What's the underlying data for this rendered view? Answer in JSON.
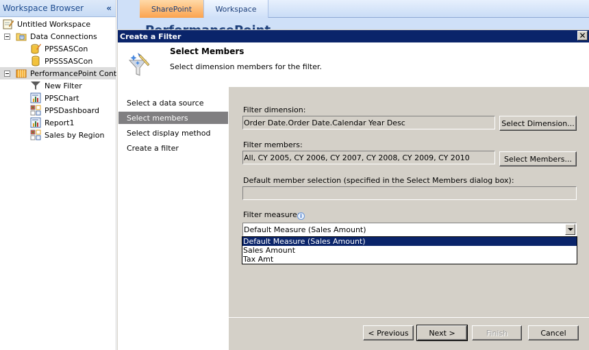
{
  "sidebar": {
    "title": "Workspace Browser",
    "collapse_glyph": "«",
    "tree": [
      {
        "label": "Untitled Workspace",
        "icon": "workspace-icon",
        "level": 0
      },
      {
        "label": "Data Connections",
        "icon": "data-connections-folder-icon",
        "level": 0,
        "expanded": true
      },
      {
        "label": "PPSSASCon",
        "icon": "data-source-edit-icon",
        "level": 1
      },
      {
        "label": "PPSSSASCon",
        "icon": "database-icon",
        "level": 1
      },
      {
        "label": "PerformancePoint Content",
        "icon": "pps-content-folder-icon",
        "level": 0,
        "expanded": true,
        "selected": true
      },
      {
        "label": "New Filter",
        "icon": "filter-icon",
        "level": 1
      },
      {
        "label": "PPSChart",
        "icon": "chart-report-icon",
        "level": 1
      },
      {
        "label": "PPSDashboard",
        "icon": "dashboard-icon",
        "level": 1
      },
      {
        "label": "Report1",
        "icon": "chart-report-icon",
        "level": 1
      },
      {
        "label": "Sales by Region",
        "icon": "dashboard-icon",
        "level": 1
      }
    ]
  },
  "topbar": {
    "tabs": [
      {
        "label": "SharePoint",
        "active": true
      },
      {
        "label": "Workspace",
        "active": false
      }
    ],
    "hidden_heading": "PerformancePoint Content"
  },
  "dialog": {
    "title": "Create a Filter",
    "close_glyph": "✕",
    "step_title": "Select Members",
    "step_description": "Select dimension members for the filter.",
    "steps": [
      {
        "label": "Select a data source",
        "active": false
      },
      {
        "label": "Select members",
        "active": true
      },
      {
        "label": "Select display method",
        "active": false
      },
      {
        "label": "Create a filter",
        "active": false
      }
    ],
    "filter_dimension": {
      "label": "Filter dimension:",
      "value": "Order Date.Order Date.Calendar Year Desc",
      "button": "Select Dimension..."
    },
    "filter_members": {
      "label": "Filter members:",
      "value": "All, CY 2005, CY 2006, CY 2007, CY 2008, CY 2009, CY 2010",
      "button": "Select Members..."
    },
    "default_member": {
      "label": "Default member selection (specified in the Select Members dialog box):",
      "value": ""
    },
    "filter_measure": {
      "label": "Filter measure:",
      "info_glyph": "i",
      "selected": "Default Measure (Sales Amount)",
      "options": [
        "Default Measure (Sales Amount)",
        "Sales Amount",
        "Tax Amt"
      ],
      "highlighted_index": 0
    },
    "buttons": {
      "previous": "< Previous",
      "next": "Next >",
      "finish": "Finish",
      "cancel": "Cancel"
    }
  },
  "colors": {
    "titlebar": "#0a246a",
    "dialog_face": "#d4d0c8",
    "active_step": "#807f81",
    "active_tab": "#fba34e",
    "sidebar_title": "#1d4b8f"
  }
}
